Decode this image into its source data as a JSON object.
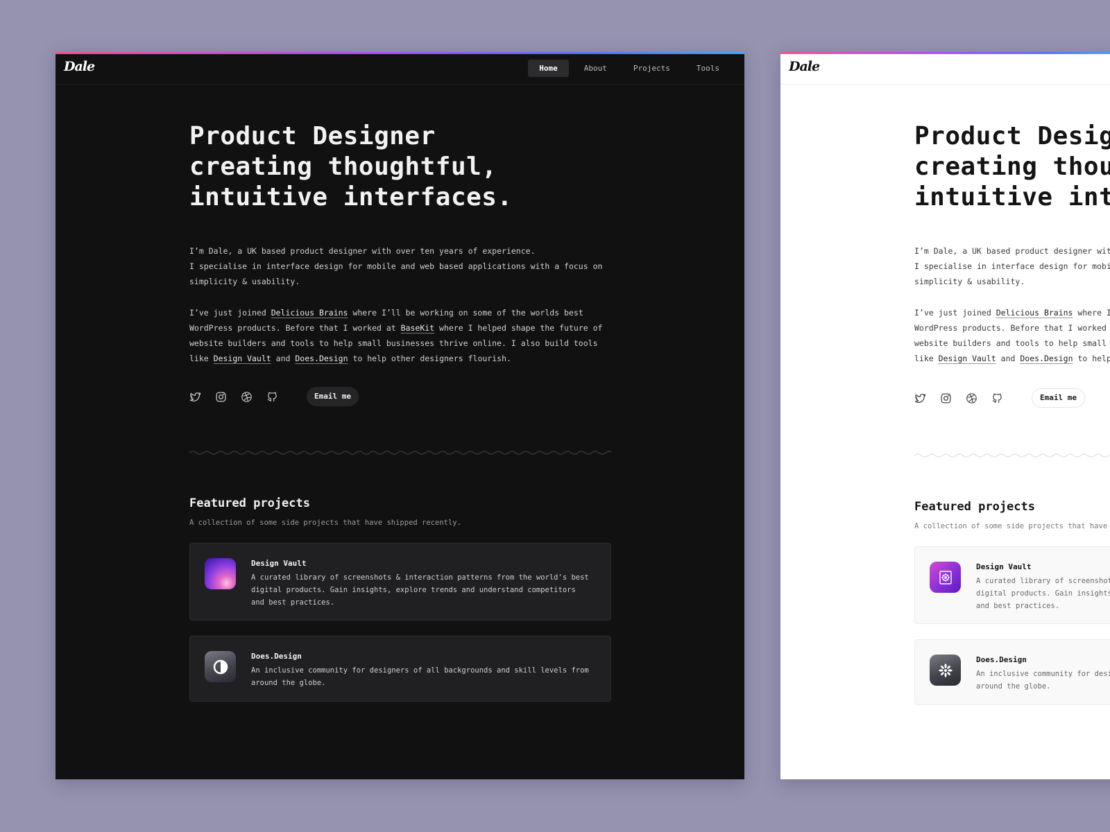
{
  "brand": {
    "logo_text": "Dale"
  },
  "nav": {
    "items": [
      {
        "label": "Home",
        "active": true
      },
      {
        "label": "About",
        "active": false
      },
      {
        "label": "Projects",
        "active": false
      },
      {
        "label": "Tools",
        "active": false
      }
    ]
  },
  "hero": {
    "headline_line1": "Product Designer",
    "headline_line2": "creating thoughtful,",
    "headline_line3": "intuitive interfaces."
  },
  "bio": {
    "p1_line1": "I’m Dale, a UK based product designer with over ten years of experience.",
    "p1_line2": "I specialise in interface design for mobile and web based applications with a focus on simplicity & usability.",
    "p2_part1": "I’ve just joined ",
    "p2_link1": "Delicious Brains",
    "p2_part2": " where I’ll be working on some of the worlds best WordPress products. Before that I worked at ",
    "p2_link2": "BaseKit",
    "p2_part3": " where I helped shape the future of website builders and tools to help small businesses thrive online. I also build tools like ",
    "p2_link3": "Design Vault",
    "p2_part4": " and ",
    "p2_link4": "Does.Design",
    "p2_part5": " to help other designers flourish."
  },
  "socials": {
    "icons": [
      "twitter-icon",
      "instagram-icon",
      "dribbble-icon",
      "github-icon"
    ],
    "email_label": "Email me"
  },
  "featured": {
    "title": "Featured projects",
    "subtitle": "A collection of some side projects that have shipped recently.",
    "projects": [
      {
        "title": "Design Vault",
        "description": "A curated library of screenshots & interaction patterns from the world's best digital products. Gain insights, explore trends and understand competitors and best practices."
      },
      {
        "title": "Does.Design",
        "description": "An inclusive community for designers of all backgrounds and skill levels from around the globe."
      }
    ]
  },
  "colors": {
    "backdrop": "#9593b0",
    "dark_bg": "#111112",
    "light_bg": "#ffffff",
    "accent_gradient": [
      "#ff4d8d",
      "#b04dff",
      "#5b6dff",
      "#3fa9ff"
    ]
  }
}
